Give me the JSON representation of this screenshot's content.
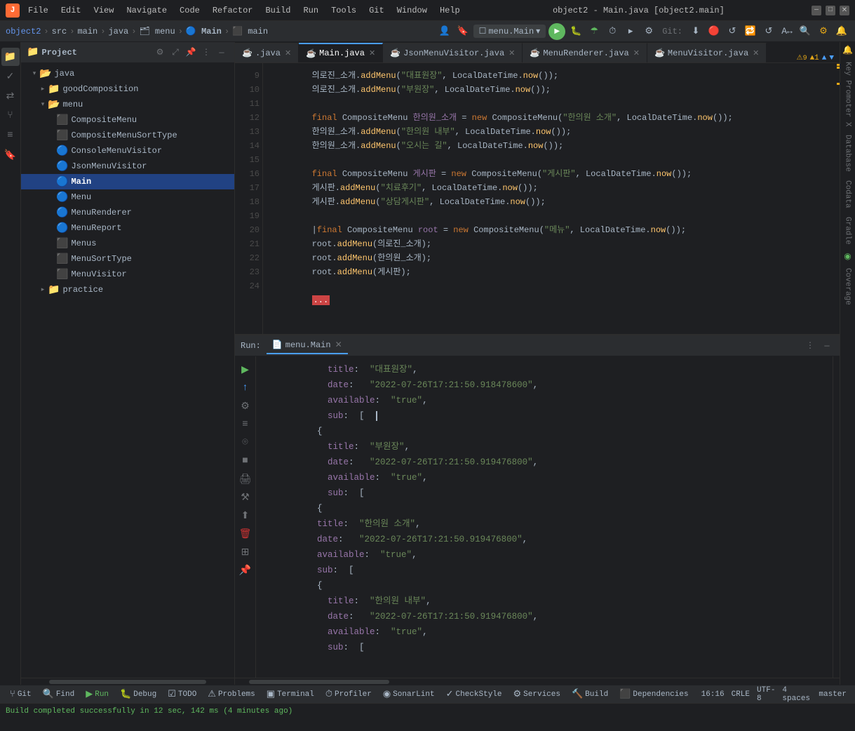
{
  "titlebar": {
    "app_icon": "J",
    "menus": [
      "File",
      "Edit",
      "View",
      "Navigate",
      "Code",
      "Refactor",
      "Build",
      "Run",
      "Tools",
      "Git",
      "Window",
      "Help"
    ],
    "title": "object2 - Main.java [object2.main]",
    "win_controls": [
      "—",
      "□",
      "✕"
    ]
  },
  "navbar": {
    "path": [
      "object2",
      "src",
      "main",
      "java",
      "menu",
      "Main",
      "main"
    ],
    "branch_label": "menu.Main",
    "git_label": "Git:",
    "user_icon": "👤"
  },
  "project_panel": {
    "title": "Project",
    "items": [
      {
        "label": "java",
        "type": "folder",
        "indent": 8,
        "expanded": true
      },
      {
        "label": "goodComposition",
        "type": "folder",
        "indent": 20,
        "expanded": false
      },
      {
        "label": "menu",
        "type": "folder",
        "indent": 20,
        "expanded": true
      },
      {
        "label": "CompositeMenu",
        "type": "class",
        "indent": 32,
        "expanded": false
      },
      {
        "label": "CompositeMenuSortType",
        "type": "class",
        "indent": 32,
        "expanded": false
      },
      {
        "label": "ConsoleMenuVisitor",
        "type": "class",
        "indent": 32,
        "expanded": false
      },
      {
        "label": "JsonMenuVisitor",
        "type": "class",
        "indent": 32,
        "expanded": false
      },
      {
        "label": "Main",
        "type": "class_active",
        "indent": 32,
        "expanded": false
      },
      {
        "label": "Menu",
        "type": "class",
        "indent": 32,
        "expanded": false
      },
      {
        "label": "MenuRenderer",
        "type": "class",
        "indent": 32,
        "expanded": false
      },
      {
        "label": "MenuReport",
        "type": "class",
        "indent": 32,
        "expanded": false
      },
      {
        "label": "Menus",
        "type": "class",
        "indent": 32,
        "expanded": false
      },
      {
        "label": "MenuSortType",
        "type": "class",
        "indent": 32,
        "expanded": false
      },
      {
        "label": "MenuVisitor",
        "type": "interface",
        "indent": 32,
        "expanded": false
      },
      {
        "label": "practice",
        "type": "folder",
        "indent": 20,
        "expanded": false
      }
    ]
  },
  "tabs": [
    {
      "label": ".java",
      "icon": "☕",
      "active": false,
      "closeable": true
    },
    {
      "label": "Main.java",
      "icon": "☕",
      "active": true,
      "closeable": true
    },
    {
      "label": "JsonMenuVisitor.java",
      "icon": "☕",
      "active": false,
      "closeable": true
    },
    {
      "label": "MenuRenderer.java",
      "icon": "☕",
      "active": false,
      "closeable": true
    },
    {
      "label": "MenuVisitor.java",
      "icon": "☕",
      "active": false,
      "closeable": true
    }
  ],
  "code": {
    "lines": [
      {
        "num": 9,
        "content": "        의로진_소개.addMenu(\"대표원장\", LocalDateTime.now());"
      },
      {
        "num": 10,
        "content": "        의로진_소개.addMenu(\"부원장\", LocalDateTime.now());"
      },
      {
        "num": 11,
        "content": ""
      },
      {
        "num": 12,
        "content": "        final CompositeMenu 한의원_소개 = new CompositeMenu(\"한의원 소개\", LocalDateTime.now());"
      },
      {
        "num": 13,
        "content": "        한의원_소개.addMenu(\"한의원 내부\", LocalDateTime.now());"
      },
      {
        "num": 14,
        "content": "        한의원_소개.addMenu(\"오시는 길\", LocalDateTime.now());"
      },
      {
        "num": 15,
        "content": ""
      },
      {
        "num": 16,
        "content": "        final CompositeMenu 게시판 = new CompositeMenu(\"게시판\", LocalDateTime.now());"
      },
      {
        "num": 17,
        "content": "        게시판.addMenu(\"치료후기\", LocalDateTime.now());"
      },
      {
        "num": 18,
        "content": "        게시판.addMenu(\"상담게시판\", LocalDateTime.now());"
      },
      {
        "num": 19,
        "content": ""
      },
      {
        "num": 20,
        "content": "        final CompositeMenu root = new CompositeMenu(\"메뉴\", LocalDateTime.now());"
      },
      {
        "num": 21,
        "content": "        root.addMenu(의로진_소개);"
      },
      {
        "num": 22,
        "content": "        root.addMenu(한의원_소개);"
      },
      {
        "num": 23,
        "content": "        root.addMenu(게시판);"
      },
      {
        "num": 24,
        "content": ""
      }
    ]
  },
  "run_panel": {
    "label": "Run:",
    "tab": "menu.Main",
    "output": [
      "            title:  \"대표원장\",",
      "            date:   \"2022-07-26T17:21:50.918478600\",",
      "            available:  \"true\",",
      "            sub:  [  |",
      "          {",
      "            title:  \"부원장\",",
      "            date:   \"2022-07-26T17:21:50.919476800\",",
      "            available:  \"true\",",
      "            sub:  [",
      "          {",
      "          title:  \"한의원 소개\",",
      "          date:   \"2022-07-26T17:21:50.919476800\",",
      "          available:  \"true\",",
      "          sub:  [",
      "          {",
      "            title:  \"한의원 내부\",",
      "            date:   \"2022-07-26T17:21:50.919476800\",",
      "            available:  \"true\",",
      "            sub:  ["
    ]
  },
  "status_bar": {
    "git_label": "Git",
    "find_label": "Find",
    "run_label": "Run",
    "debug_label": "Debug",
    "todo_label": "TODO",
    "problems_label": "Problems",
    "terminal_label": "Terminal",
    "profiler_label": "Profiler",
    "sonarlint_label": "SonarLint",
    "checkstyle_label": "CheckStyle",
    "services_label": "Services",
    "build_label": "Build",
    "dependencies_label": "Dependencies",
    "position": "16:16",
    "encoding": "CRLE   UTF-8",
    "indent": "4 spaces",
    "git_branch": "master"
  },
  "gutter": {
    "warn_count": "⚠9",
    "error_count": "▲1"
  }
}
